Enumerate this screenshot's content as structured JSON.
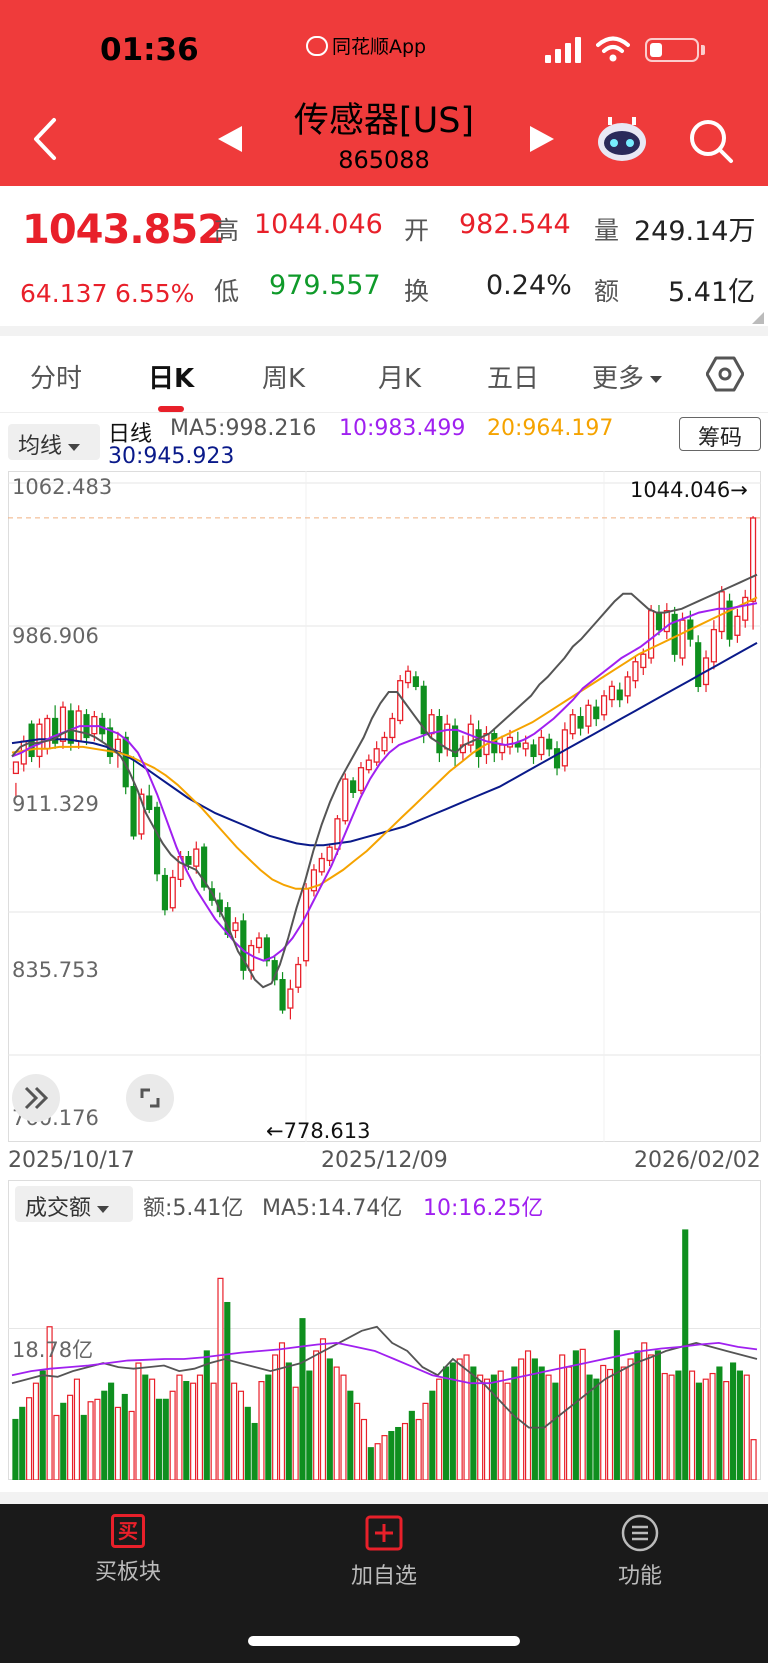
{
  "status_bar": {
    "time": "01:36",
    "app_label": "同花顺App"
  },
  "header": {
    "title": "传感器[US]",
    "code": "865088"
  },
  "quote": {
    "price": "1043.852",
    "change": "64.137",
    "change_pct": "6.55%",
    "high_label": "高",
    "high": "1044.046",
    "open_label": "开",
    "open": "982.544",
    "volume_label": "量",
    "volume": "249.14万",
    "low_label": "低",
    "low": "979.557",
    "turnover_label": "换",
    "turnover": "0.24%",
    "amount_label": "额",
    "amount": "5.41亿"
  },
  "tabs": [
    "分时",
    "日K",
    "周K",
    "月K",
    "五日",
    "更多"
  ],
  "active_tab": 1,
  "ma_panel": {
    "button": "均线",
    "period": "日线",
    "ma5": "MA5:998.216",
    "ma10": "10:983.499",
    "ma20": "20:964.197",
    "ma30": "30:945.923",
    "chips_button": "筹码"
  },
  "vol_panel": {
    "button": "成交额",
    "amount": "额:5.41亿",
    "ma5": "MA5:14.74亿",
    "ma10": "10:16.25亿",
    "level_label": "18.78亿"
  },
  "colors": {
    "up": "#e8202a",
    "down": "#0f8f1f",
    "ma5": "#555555",
    "ma10": "#a020f0",
    "ma20": "#f5a300",
    "ma30": "#0a1a8a",
    "brand": "#ef3b3b"
  },
  "chart_data": [
    {
      "type": "candlestick",
      "title": "",
      "y_ticks": [
        1062.483,
        986.906,
        911.329,
        835.753,
        760.176
      ],
      "ylim": [
        760.176,
        1062.483
      ],
      "x_labels": [
        "2025/10/17",
        "2025/12/09",
        "2026/02/02"
      ],
      "high_marker": "1044.046→",
      "low_marker": "←778.613",
      "high_value": 1044.046,
      "low_value": 778.613,
      "candles": [
        [
          909,
          915,
          904,
          896
        ],
        [
          914,
          926,
          929,
          910
        ],
        [
          935,
          918,
          937,
          915
        ],
        [
          918,
          935,
          938,
          912
        ],
        [
          922,
          938,
          940,
          919
        ],
        [
          938,
          925,
          945,
          922
        ],
        [
          926,
          944,
          947,
          922
        ],
        [
          942,
          925,
          946,
          921
        ],
        [
          926,
          942,
          945,
          922
        ],
        [
          940,
          928,
          943,
          924
        ],
        [
          930,
          939,
          942,
          926
        ],
        [
          938,
          930,
          941,
          926
        ],
        [
          933,
          918,
          938,
          914
        ],
        [
          920,
          927,
          931,
          912
        ],
        [
          928,
          902,
          931,
          898
        ],
        [
          902,
          876,
          918,
          874
        ],
        [
          877,
          898,
          901,
          874
        ],
        [
          897,
          890,
          903,
          888
        ],
        [
          891,
          856,
          894,
          852
        ],
        [
          855,
          837,
          859,
          834
        ],
        [
          838,
          854,
          858,
          836
        ],
        [
          853,
          865,
          868,
          849
        ],
        [
          865,
          861,
          868,
          858
        ],
        [
          860,
          869,
          873,
          856
        ],
        [
          870,
          849,
          872,
          847
        ],
        [
          848,
          842,
          852,
          839
        ],
        [
          842,
          836,
          846,
          833
        ],
        [
          838,
          824,
          841,
          822
        ],
        [
          826,
          830,
          833,
          822
        ],
        [
          831,
          805,
          835,
          800
        ],
        [
          805,
          818,
          821,
          800
        ],
        [
          817,
          822,
          825,
          814
        ],
        [
          822,
          810,
          824,
          807
        ],
        [
          810,
          800,
          813,
          797
        ],
        [
          800,
          784,
          804,
          782
        ],
        [
          785,
          795,
          800,
          779
        ],
        [
          796,
          808,
          812,
          793
        ],
        [
          810,
          848,
          851,
          807
        ],
        [
          847,
          858,
          861,
          844
        ],
        [
          857,
          864,
          867,
          855
        ],
        [
          863,
          870,
          872,
          860
        ],
        [
          869,
          885,
          887,
          866
        ],
        [
          884,
          906,
          909,
          882
        ],
        [
          905,
          899,
          907,
          896
        ],
        [
          900,
          912,
          915,
          898
        ],
        [
          911,
          916,
          919,
          909
        ],
        [
          915,
          922,
          926,
          913
        ],
        [
          921,
          928,
          931,
          919
        ],
        [
          928,
          938,
          941,
          925
        ],
        [
          937,
          958,
          961,
          935
        ],
        [
          957,
          963,
          966,
          954
        ],
        [
          960,
          955,
          963,
          953
        ],
        [
          955,
          930,
          958,
          925
        ],
        [
          930,
          940,
          943,
          927
        ],
        [
          939,
          920,
          943,
          915
        ],
        [
          922,
          935,
          940,
          918
        ],
        [
          934,
          918,
          938,
          912
        ],
        [
          920,
          924,
          929,
          916
        ],
        [
          924,
          935,
          940,
          920
        ],
        [
          932,
          918,
          937,
          912
        ],
        [
          919,
          930,
          934,
          914
        ],
        [
          930,
          920,
          933,
          915
        ],
        [
          920,
          924,
          929,
          916
        ],
        [
          923,
          928,
          932,
          919
        ],
        [
          925,
          923,
          931,
          920
        ],
        [
          922,
          925,
          929,
          918
        ],
        [
          924,
          918,
          927,
          914
        ],
        [
          919,
          928,
          932,
          916
        ],
        [
          927,
          922,
          930,
          918
        ],
        [
          922,
          912,
          926,
          908
        ],
        [
          913,
          932,
          936,
          910
        ],
        [
          930,
          940,
          943,
          927
        ],
        [
          939,
          933,
          944,
          929
        ],
        [
          934,
          945,
          948,
          930
        ],
        [
          944,
          938,
          948,
          934
        ],
        [
          940,
          950,
          953,
          937
        ],
        [
          948,
          955,
          958,
          944
        ],
        [
          953,
          948,
          957,
          944
        ],
        [
          950,
          960,
          963,
          946
        ],
        [
          958,
          968,
          971,
          954
        ],
        [
          965,
          972,
          975,
          961
        ],
        [
          970,
          995,
          998,
          967
        ],
        [
          994,
          985,
          998,
          982
        ],
        [
          984,
          995,
          999,
          980
        ],
        [
          993,
          972,
          997,
          968
        ],
        [
          970,
          990,
          994,
          966
        ],
        [
          990,
          980,
          995,
          976
        ],
        [
          978,
          955,
          982,
          952
        ],
        [
          956,
          970,
          974,
          952
        ],
        [
          968,
          985,
          990,
          964
        ],
        [
          984,
          1005,
          1008,
          980
        ],
        [
          1000,
          980,
          1004,
          976
        ],
        [
          982,
          992,
          996,
          978
        ],
        [
          990,
          1002,
          1006,
          986
        ],
        [
          1000,
          1044,
          1045,
          985
        ]
      ],
      "ma5": [
        918,
        923,
        925,
        925,
        926,
        927,
        930,
        932,
        931,
        930,
        928,
        925,
        922,
        918,
        910,
        900,
        888,
        880,
        872,
        866,
        862,
        860,
        858,
        852,
        845,
        835,
        826,
        815,
        808,
        800,
        796,
        798,
        808,
        822,
        838,
        852,
        868,
        882,
        894,
        904,
        912,
        920,
        928,
        938,
        946,
        952,
        952,
        946,
        940,
        934,
        928,
        925,
        922,
        920,
        924,
        926,
        928,
        930,
        934,
        938,
        942,
        946,
        950,
        956,
        960,
        965,
        970,
        976,
        980,
        985,
        990,
        995,
        1000,
        1004,
        1004,
        1000,
        996,
        994,
        994,
        995,
        996,
        998,
        1000,
        1002,
        1004,
        1006,
        1008,
        1010,
        1012,
        1014
      ],
      "ma10": [
        918,
        920,
        923,
        925,
        928,
        930,
        932,
        934,
        934,
        934,
        932,
        930,
        926,
        920,
        910,
        898,
        884,
        870,
        858,
        848,
        840,
        832,
        826,
        820,
        815,
        812,
        810,
        812,
        816,
        822,
        830,
        840,
        850,
        860,
        872,
        884,
        896,
        906,
        914,
        920,
        924,
        926,
        928,
        930,
        931,
        932,
        932,
        930,
        928,
        926,
        925,
        924,
        925,
        927,
        930,
        934,
        938,
        943,
        948,
        954,
        958,
        962,
        966,
        970,
        973,
        976,
        980,
        984,
        988,
        990,
        992,
        994,
        995,
        996,
        996,
        997,
        998,
        999
      ],
      "ma20": [
        920,
        921,
        922,
        922,
        923,
        923,
        923,
        922,
        921,
        920,
        918,
        915,
        912,
        908,
        903,
        897,
        891,
        884,
        877,
        870,
        864,
        858,
        853,
        850,
        848,
        848,
        850,
        854,
        858,
        863,
        868,
        874,
        880,
        886,
        892,
        898,
        904,
        910,
        915,
        920,
        924,
        927,
        930,
        933,
        936,
        940,
        944,
        948,
        952,
        956,
        960,
        964,
        968,
        972,
        975,
        978,
        981,
        984,
        987,
        990,
        993,
        996,
        999,
        1002
      ],
      "ma30": [
        925,
        926,
        927,
        927,
        927,
        926,
        925,
        923,
        920,
        916,
        911,
        906,
        901,
        896,
        892,
        888,
        885,
        882,
        879,
        876,
        874,
        872,
        871,
        871,
        872,
        873,
        875,
        877,
        879,
        881,
        884,
        887,
        890,
        893,
        896,
        899,
        902,
        906,
        910,
        914,
        918,
        922,
        926,
        930,
        934,
        938,
        942,
        946,
        950,
        954,
        958,
        962,
        966,
        970,
        974,
        978
      ]
    },
    {
      "type": "bar",
      "title": "",
      "unit": "亿",
      "y_ticks": [
        18.78
      ],
      "ylim": [
        0,
        31
      ],
      "values": [
        7.5,
        9,
        10.2,
        12,
        13.5,
        19,
        8,
        9.5,
        10.5,
        12.5,
        8,
        9.7,
        10,
        11,
        12,
        9,
        10.6,
        8.5,
        14.5,
        13,
        12.5,
        10,
        10,
        11,
        13,
        12.2,
        12,
        13,
        16,
        12,
        25,
        22,
        12,
        11,
        9,
        7,
        12.2,
        13,
        15.5,
        17,
        14.5,
        11.5,
        20,
        13.5,
        16,
        17.5,
        15,
        14,
        13,
        11,
        9.5,
        7.5,
        4,
        4.5,
        5.5,
        6,
        6.5,
        7,
        8.5,
        7.5,
        9.5,
        11,
        12.5,
        14,
        14.5,
        15,
        15.5,
        14,
        13,
        12.5,
        13,
        13.5,
        12,
        14,
        15,
        16,
        15,
        14,
        13,
        12,
        15.5,
        14,
        16,
        16.2,
        13,
        12.5,
        14.2,
        13.7,
        18.5,
        14,
        15,
        16,
        17,
        15.5,
        16,
        13.2,
        13,
        13.5,
        31,
        13.5,
        12,
        12.5,
        13.2,
        14,
        12.2,
        14.5,
        13.5,
        13,
        5
      ],
      "ma_line_a": [
        12,
        12.5,
        13,
        12.8,
        13.5,
        14,
        14.5,
        14,
        13.8,
        14,
        14.2,
        13.5,
        13.8,
        14.5,
        15,
        14.5,
        14,
        13.5,
        14,
        14.5,
        15.5,
        16.5,
        17.5,
        18.5,
        19,
        17,
        16,
        14,
        13,
        15,
        13.5,
        12,
        10,
        8,
        6.5,
        6.5,
        8,
        9.5,
        11,
        12.5,
        13.5,
        14.5,
        15.2,
        16,
        16.5,
        17,
        16.5,
        16,
        15.5,
        15
      ],
      "ma_line_b": [
        13,
        13.5,
        13.8,
        14,
        14.2,
        14.5,
        14.8,
        14.9,
        15,
        15,
        15.2,
        15.5,
        15.8,
        16,
        16.2,
        16.5,
        16.8,
        17,
        16.5,
        16,
        15,
        14,
        13,
        12.5,
        12,
        12,
        12.5,
        13,
        13.5,
        14,
        14.5,
        15,
        15.5,
        16,
        16.3,
        16.5,
        16.8,
        17,
        16.5,
        16.2
      ]
    }
  ],
  "bottom_bar": {
    "buy_icon": "买",
    "buy": "买板块",
    "add": "加自选",
    "func": "功能"
  }
}
